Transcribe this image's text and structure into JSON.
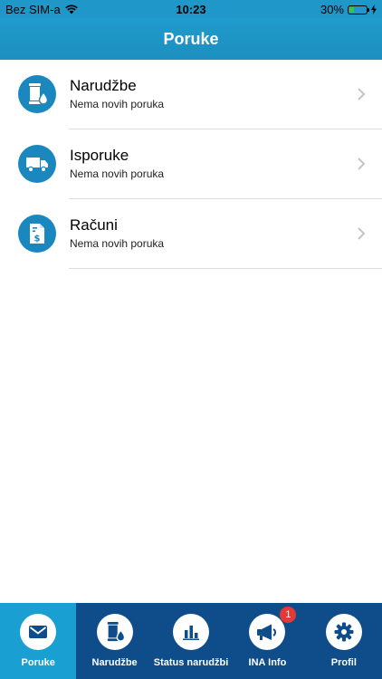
{
  "status_bar": {
    "carrier": "Bez SIM-a",
    "time": "10:23",
    "battery_percent_text": "30%",
    "battery_level": 0.3
  },
  "header": {
    "title": "Poruke"
  },
  "messages": [
    {
      "title": "Narudžbe",
      "subtitle": "Nema novih poruka",
      "icon": "barrel-drop-icon"
    },
    {
      "title": "Isporuke",
      "subtitle": "Nema novih poruka",
      "icon": "truck-icon"
    },
    {
      "title": "Računi",
      "subtitle": "Nema novih poruka",
      "icon": "invoice-dollar-icon"
    }
  ],
  "tabs": [
    {
      "label": "Poruke",
      "icon": "envelope-icon",
      "active": true
    },
    {
      "label": "Narudžbe",
      "icon": "barrel-drop-icon",
      "active": false
    },
    {
      "label": "Status narudžbi",
      "icon": "bar-chart-icon",
      "active": false
    },
    {
      "label": "INA Info",
      "icon": "megaphone-icon",
      "active": false,
      "badge": "1"
    },
    {
      "label": "Profil",
      "icon": "gear-icon",
      "active": false
    }
  ],
  "colors": {
    "header": "#209bcb",
    "icon_circle": "#1a87bf",
    "tabbar": "#0e4d8a",
    "tab_active": "#1a9fd2",
    "badge": "#e53935"
  }
}
